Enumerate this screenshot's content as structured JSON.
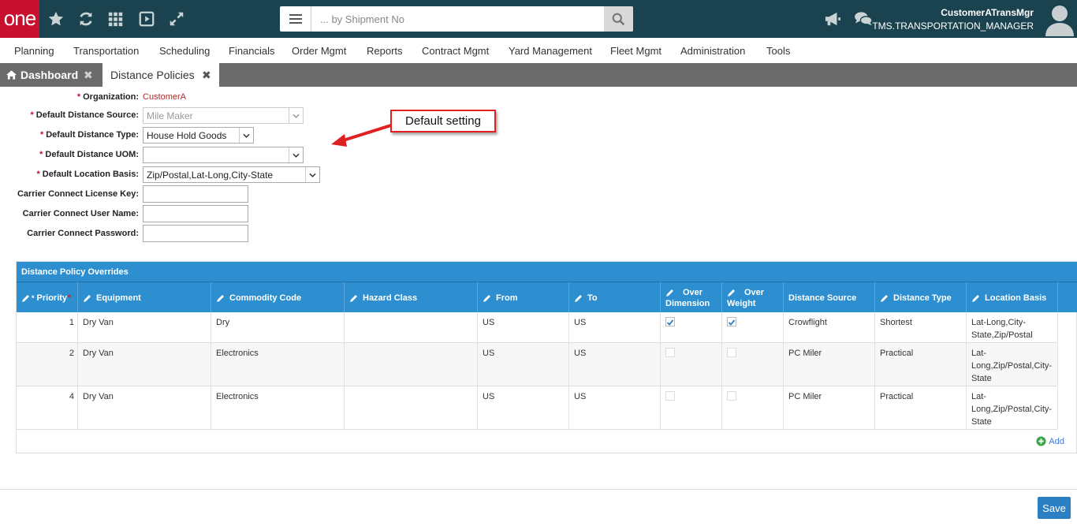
{
  "app": {
    "logo": "one"
  },
  "search": {
    "placeholder": "... by Shipment No"
  },
  "user": {
    "name": "CustomerATransMgr",
    "role": "TMS.TRANSPORTATION_MANAGER"
  },
  "menu": [
    "Planning",
    "Transportation",
    "Scheduling",
    "Financials",
    "Order Mgmt",
    "Reports",
    "Contract Mgmt",
    "Yard Management",
    "Fleet Mgmt",
    "Administration",
    "Tools"
  ],
  "tabs": {
    "dashboard": "Dashboard",
    "current": "Distance Policies"
  },
  "form": {
    "organization_label": "Organization:",
    "organization_value": "CustomerA",
    "source_label": "Default Distance Source:",
    "source_value": "Mile Maker",
    "type_label": "Default Distance Type:",
    "type_value": "House Hold Goods",
    "uom_label": "Default Distance UOM:",
    "uom_value": "",
    "basis_label": "Default Location Basis:",
    "basis_value": "Zip/Postal,Lat-Long,City-State",
    "license_label": "Carrier Connect License Key:",
    "username_label": "Carrier Connect User Name:",
    "password_label": "Carrier Connect Password:"
  },
  "callout": {
    "text": "Default setting"
  },
  "grid": {
    "title": "Distance Policy Overrides",
    "headers": {
      "priority": "Priority",
      "equipment": "Equipment",
      "commodity": "Commodity Code",
      "hazard": "Hazard Class",
      "from": "From",
      "to": "To",
      "over_dim_1": "Over",
      "over_dim_2": "Dimension",
      "over_wt_1": "Over",
      "over_wt_2": "Weight",
      "source": "Distance Source",
      "type": "Distance Type",
      "basis": "Location Basis"
    },
    "rows": [
      {
        "priority": "1",
        "equipment": "Dry Van",
        "commodity": "Dry",
        "hazard": "",
        "from": "US",
        "to": "US",
        "over_dim": true,
        "over_wt": true,
        "source": "Crowflight",
        "type": "Shortest",
        "basis": "Lat-Long,City-State,Zip/Postal"
      },
      {
        "priority": "2",
        "equipment": "Dry Van",
        "commodity": "Electronics",
        "hazard": "",
        "from": "US",
        "to": "US",
        "over_dim": false,
        "over_wt": false,
        "source": "PC Miler",
        "type": "Practical",
        "basis": "Lat-Long,Zip/Postal,City-State"
      },
      {
        "priority": "4",
        "equipment": "Dry Van",
        "commodity": "Electronics",
        "hazard": "",
        "from": "US",
        "to": "US",
        "over_dim": false,
        "over_wt": false,
        "source": "PC Miler",
        "type": "Practical",
        "basis": "Lat-Long,Zip/Postal,City-State"
      }
    ],
    "add_label": "Add"
  },
  "footer": {
    "save_label": "Save"
  },
  "colors": {
    "topbar": "#1a434f",
    "brand": "#c8102e",
    "grid_header": "#2d8fd0",
    "tabbar": "#6b6b6b",
    "save": "#2d7fc4"
  }
}
